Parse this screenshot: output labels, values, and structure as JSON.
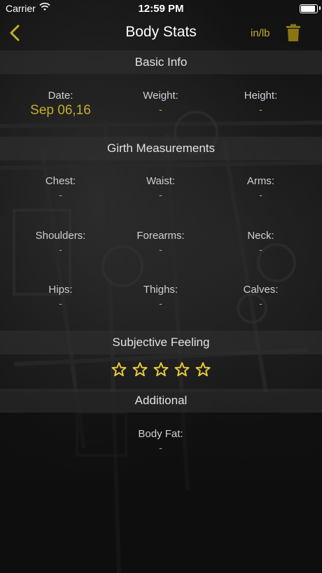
{
  "status_bar": {
    "carrier": "Carrier",
    "time": "12:59 PM",
    "battery_level": 1.0
  },
  "nav": {
    "title": "Body Stats",
    "units_label": "in/lb"
  },
  "sections": {
    "basic_info": "Basic Info",
    "girth": "Girth Measurements",
    "feeling": "Subjective Feeling",
    "additional": "Additional"
  },
  "basic_info": {
    "date": {
      "label": "Date:",
      "value": "Sep 06,16"
    },
    "weight": {
      "label": "Weight:",
      "value": "-"
    },
    "height": {
      "label": "Height:",
      "value": "-"
    }
  },
  "girth": {
    "chest": {
      "label": "Chest:",
      "value": "-"
    },
    "waist": {
      "label": "Waist:",
      "value": "-"
    },
    "arms": {
      "label": "Arms:",
      "value": "-"
    },
    "shoulders": {
      "label": "Shoulders:",
      "value": "-"
    },
    "forearms": {
      "label": "Forearms:",
      "value": "-"
    },
    "neck": {
      "label": "Neck:",
      "value": "-"
    },
    "hips": {
      "label": "Hips:",
      "value": "-"
    },
    "thighs": {
      "label": "Thighs:",
      "value": "-"
    },
    "calves": {
      "label": "Calves:",
      "value": "-"
    }
  },
  "feeling": {
    "rating": 0,
    "max": 5
  },
  "additional": {
    "body_fat": {
      "label": "Body Fat:",
      "value": "-"
    }
  },
  "colors": {
    "accent": "#c7ad2a",
    "star_outline": "#e8c93a"
  },
  "icons": [
    "back-chevron-icon",
    "trash-icon",
    "star-icon",
    "wifi-icon",
    "battery-icon"
  ]
}
